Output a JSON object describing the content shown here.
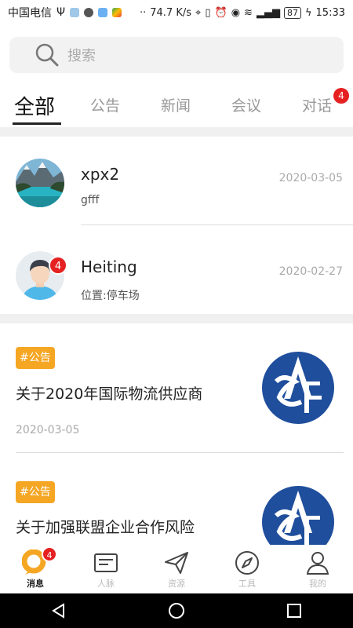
{
  "status_bar": {
    "carrier": "中国电信",
    "speed": "74.7 K/s",
    "battery": "87",
    "time": "15:33"
  },
  "search": {
    "placeholder": "搜索"
  },
  "tabs": [
    {
      "label": "全部"
    },
    {
      "label": "公告"
    },
    {
      "label": "新闻"
    },
    {
      "label": "会议"
    },
    {
      "label": "对话",
      "badge": "4"
    }
  ],
  "chats": [
    {
      "name": "xpx2",
      "subtitle": "gfff",
      "date": "2020-03-05"
    },
    {
      "name": "Heiting",
      "subtitle": "位置:停车场",
      "date": "2020-02-27",
      "badge": "4"
    }
  ],
  "news": [
    {
      "tag": "#公告",
      "title": "关于2020年国际物流供应商",
      "date": "2020-03-05"
    },
    {
      "tag": "#公告",
      "title": "关于加强联盟企业合作风险"
    }
  ],
  "bottom_nav": [
    {
      "label": "消息",
      "badge": "4"
    },
    {
      "label": "人脉"
    },
    {
      "label": "资源"
    },
    {
      "label": "工具"
    },
    {
      "label": "我的"
    }
  ],
  "colors": {
    "accent": "#f5a623",
    "badge": "#e52121",
    "logo": "#1f4e9c"
  }
}
